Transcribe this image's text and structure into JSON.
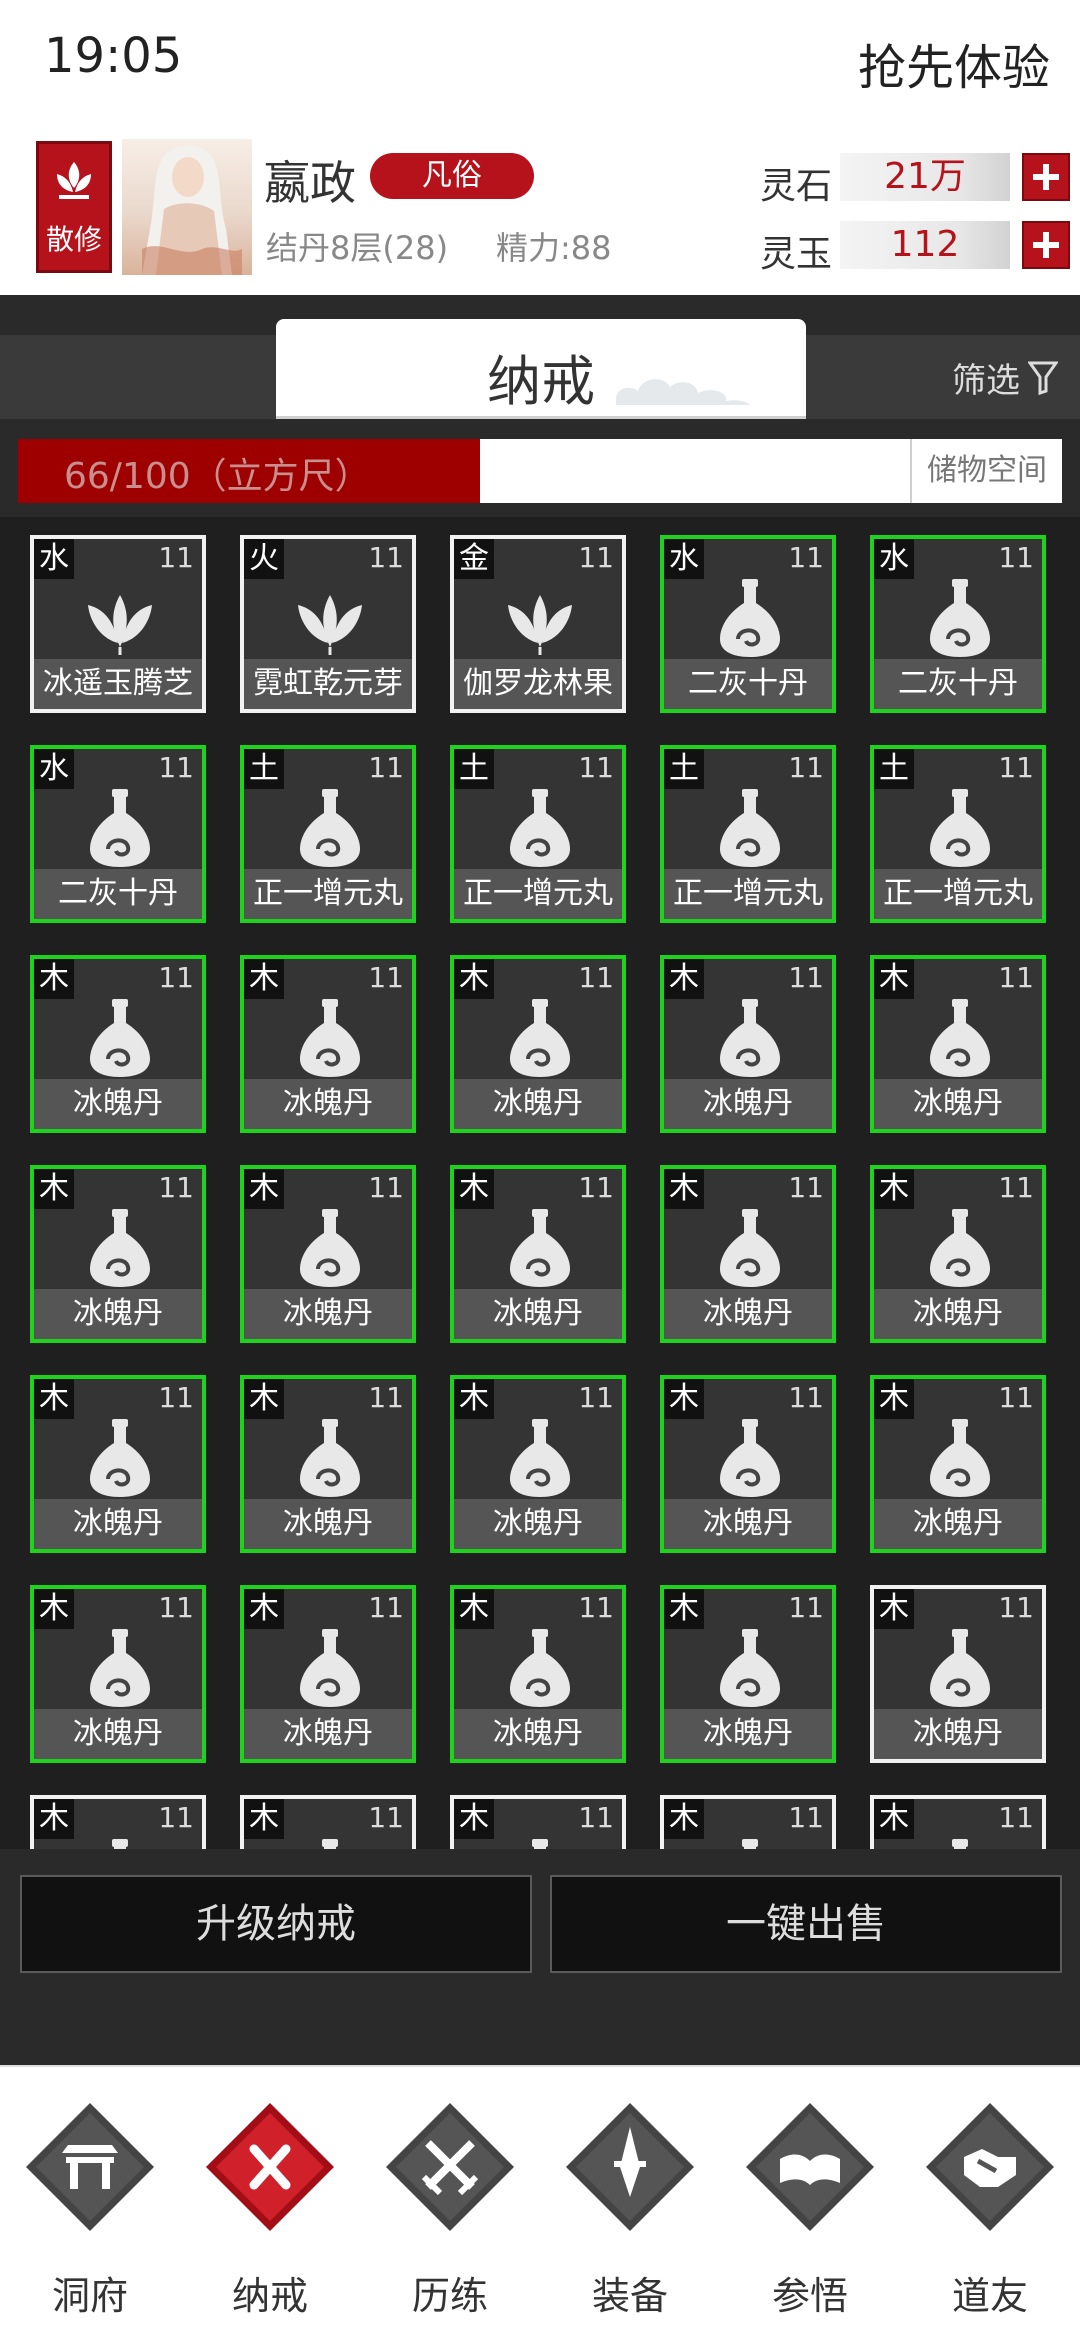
{
  "status": {
    "time": "19:05",
    "trial": "抢先体验"
  },
  "player": {
    "sect": "散修",
    "name": "嬴政",
    "rank": "凡俗",
    "realm": "结丹8层(28)",
    "energy": "精力:88"
  },
  "resources": [
    {
      "label": "灵石",
      "value": "21万"
    },
    {
      "label": "灵玉",
      "value": "112"
    }
  ],
  "ring": {
    "title": "纳戒",
    "filter_label": "筛选",
    "capacity_text": "66/100（立方尺）",
    "capacity_fraction": 0.66,
    "storage_label": "储物空间"
  },
  "items": [
    {
      "element": "水",
      "level": "11",
      "name": "冰遥玉腾芝",
      "kind": "herb",
      "border": "white"
    },
    {
      "element": "火",
      "level": "11",
      "name": "霓虹乾元芽",
      "kind": "herb",
      "border": "white"
    },
    {
      "element": "金",
      "level": "11",
      "name": "伽罗龙林果",
      "kind": "herb",
      "border": "white"
    },
    {
      "element": "水",
      "level": "11",
      "name": "二灰十丹",
      "kind": "pill",
      "border": "green"
    },
    {
      "element": "水",
      "level": "11",
      "name": "二灰十丹",
      "kind": "pill",
      "border": "green"
    },
    {
      "element": "水",
      "level": "11",
      "name": "二灰十丹",
      "kind": "pill",
      "border": "green"
    },
    {
      "element": "土",
      "level": "11",
      "name": "正一增元丸",
      "kind": "pill",
      "border": "green"
    },
    {
      "element": "土",
      "level": "11",
      "name": "正一增元丸",
      "kind": "pill",
      "border": "green"
    },
    {
      "element": "土",
      "level": "11",
      "name": "正一增元丸",
      "kind": "pill",
      "border": "green"
    },
    {
      "element": "土",
      "level": "11",
      "name": "正一增元丸",
      "kind": "pill",
      "border": "green"
    },
    {
      "element": "木",
      "level": "11",
      "name": "冰魄丹",
      "kind": "pill",
      "border": "green"
    },
    {
      "element": "木",
      "level": "11",
      "name": "冰魄丹",
      "kind": "pill",
      "border": "green"
    },
    {
      "element": "木",
      "level": "11",
      "name": "冰魄丹",
      "kind": "pill",
      "border": "green"
    },
    {
      "element": "木",
      "level": "11",
      "name": "冰魄丹",
      "kind": "pill",
      "border": "green"
    },
    {
      "element": "木",
      "level": "11",
      "name": "冰魄丹",
      "kind": "pill",
      "border": "green"
    },
    {
      "element": "木",
      "level": "11",
      "name": "冰魄丹",
      "kind": "pill",
      "border": "green"
    },
    {
      "element": "木",
      "level": "11",
      "name": "冰魄丹",
      "kind": "pill",
      "border": "green"
    },
    {
      "element": "木",
      "level": "11",
      "name": "冰魄丹",
      "kind": "pill",
      "border": "green"
    },
    {
      "element": "木",
      "level": "11",
      "name": "冰魄丹",
      "kind": "pill",
      "border": "green"
    },
    {
      "element": "木",
      "level": "11",
      "name": "冰魄丹",
      "kind": "pill",
      "border": "green"
    },
    {
      "element": "木",
      "level": "11",
      "name": "冰魄丹",
      "kind": "pill",
      "border": "green"
    },
    {
      "element": "木",
      "level": "11",
      "name": "冰魄丹",
      "kind": "pill",
      "border": "green"
    },
    {
      "element": "木",
      "level": "11",
      "name": "冰魄丹",
      "kind": "pill",
      "border": "green"
    },
    {
      "element": "木",
      "level": "11",
      "name": "冰魄丹",
      "kind": "pill",
      "border": "green"
    },
    {
      "element": "木",
      "level": "11",
      "name": "冰魄丹",
      "kind": "pill",
      "border": "green"
    },
    {
      "element": "木",
      "level": "11",
      "name": "冰魄丹",
      "kind": "pill",
      "border": "green"
    },
    {
      "element": "木",
      "level": "11",
      "name": "冰魄丹",
      "kind": "pill",
      "border": "green"
    },
    {
      "element": "木",
      "level": "11",
      "name": "冰魄丹",
      "kind": "pill",
      "border": "green"
    },
    {
      "element": "木",
      "level": "11",
      "name": "冰魄丹",
      "kind": "pill",
      "border": "green"
    },
    {
      "element": "木",
      "level": "11",
      "name": "冰魄丹",
      "kind": "pill",
      "border": "white"
    },
    {
      "element": "木",
      "level": "11",
      "name": "",
      "kind": "pill",
      "border": "white"
    },
    {
      "element": "木",
      "level": "11",
      "name": "",
      "kind": "pill",
      "border": "white"
    },
    {
      "element": "木",
      "level": "11",
      "name": "",
      "kind": "pill",
      "border": "white"
    },
    {
      "element": "木",
      "level": "11",
      "name": "",
      "kind": "pill",
      "border": "white"
    },
    {
      "element": "木",
      "level": "11",
      "name": "",
      "kind": "pill",
      "border": "white"
    }
  ],
  "actions": {
    "upgrade": "升级纳戒",
    "sell_all": "一键出售"
  },
  "nav": [
    {
      "label": "洞府",
      "icon": "gate-icon",
      "active": false
    },
    {
      "label": "纳戒",
      "icon": "ring-icon",
      "active": true
    },
    {
      "label": "历练",
      "icon": "crossed-swords-icon",
      "active": false
    },
    {
      "label": "装备",
      "icon": "dagger-icon",
      "active": false
    },
    {
      "label": "参悟",
      "icon": "book-icon",
      "active": false
    },
    {
      "label": "道友",
      "icon": "handshake-icon",
      "active": false
    }
  ],
  "colors": {
    "accent": "#b5121b",
    "rare_border": "#1ed21e",
    "common_border": "#f2f2f2"
  }
}
